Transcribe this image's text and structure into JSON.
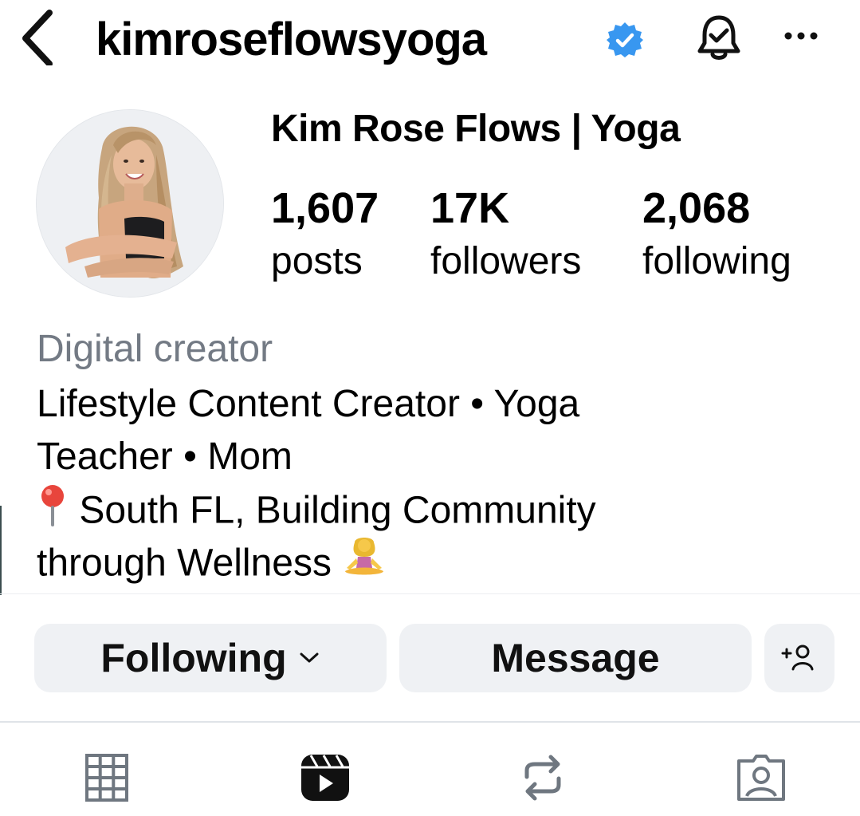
{
  "header": {
    "username": "kimroseflowsyoga",
    "verified": true,
    "icons": [
      "back-arrow",
      "verified-badge",
      "notification-bell",
      "more-options"
    ]
  },
  "profile": {
    "display_name": "Kim Rose Flows | Yoga",
    "stats": [
      {
        "count": "1,607",
        "label": "posts"
      },
      {
        "count": "17K",
        "label": "followers"
      },
      {
        "count": "2,068",
        "label": "following"
      }
    ],
    "category": "Digital creator",
    "bio_lines": [
      "Lifestyle Content Creator • Yoga",
      "Teacher • Mom",
      "South FL, Building Community",
      "through Wellness"
    ],
    "bio_emojis": [
      "round-pushpin",
      "person-in-lotus-position"
    ]
  },
  "actions": {
    "following_label": "Following",
    "message_label": "Message",
    "add_user": "+person"
  },
  "tabs": [
    "grid",
    "reels",
    "reposts",
    "tagged"
  ],
  "colors": {
    "verified_blue": "#3897f0",
    "muted_text": "#737a84",
    "button_bg": "#eff1f4",
    "tab_icon": "#6f7780"
  }
}
